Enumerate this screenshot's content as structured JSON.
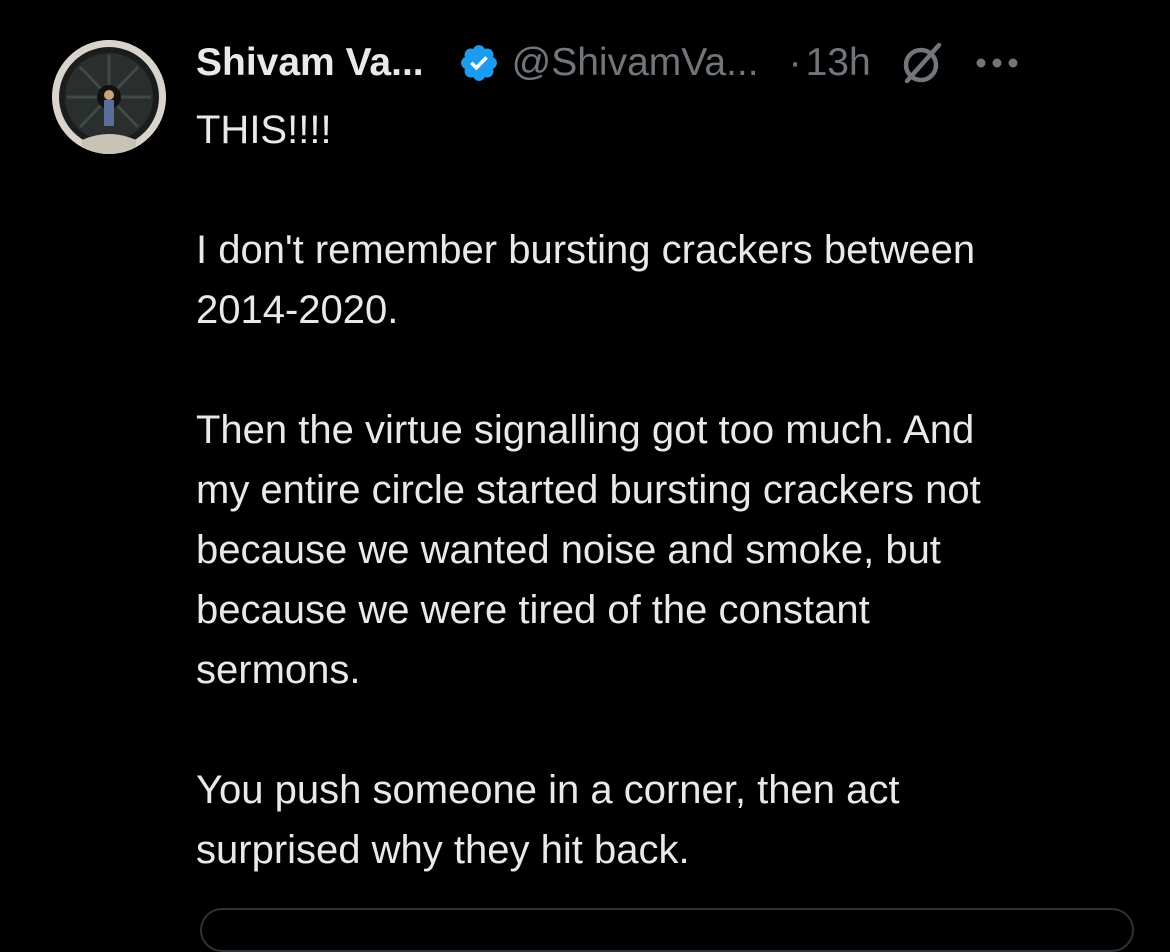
{
  "tweet": {
    "display_name": "Shivam Va...",
    "handle": "@ShivamVa...",
    "separator": "·",
    "timestamp": "13h",
    "verified": true,
    "icons": {
      "verified": "verified-badge-icon",
      "grok": "grok-icon",
      "more": "more-options-icon"
    },
    "colors": {
      "background": "#000000",
      "text": "#e7e9ea",
      "secondary": "#71767b",
      "verified": "#1d9bf0"
    },
    "body": {
      "p1": [
        "THIS!!!!"
      ],
      "p2": [
        "I don't remember bursting crackers between",
        "2014-2020."
      ],
      "p3": [
        "Then the virtue signalling got too much. And",
        "my entire circle started bursting crackers not",
        "because we wanted noise and smoke, but",
        "because we were tired of the constant",
        "sermons."
      ],
      "p4": [
        "You push someone in a corner, then act",
        "surprised why they hit back."
      ]
    }
  }
}
